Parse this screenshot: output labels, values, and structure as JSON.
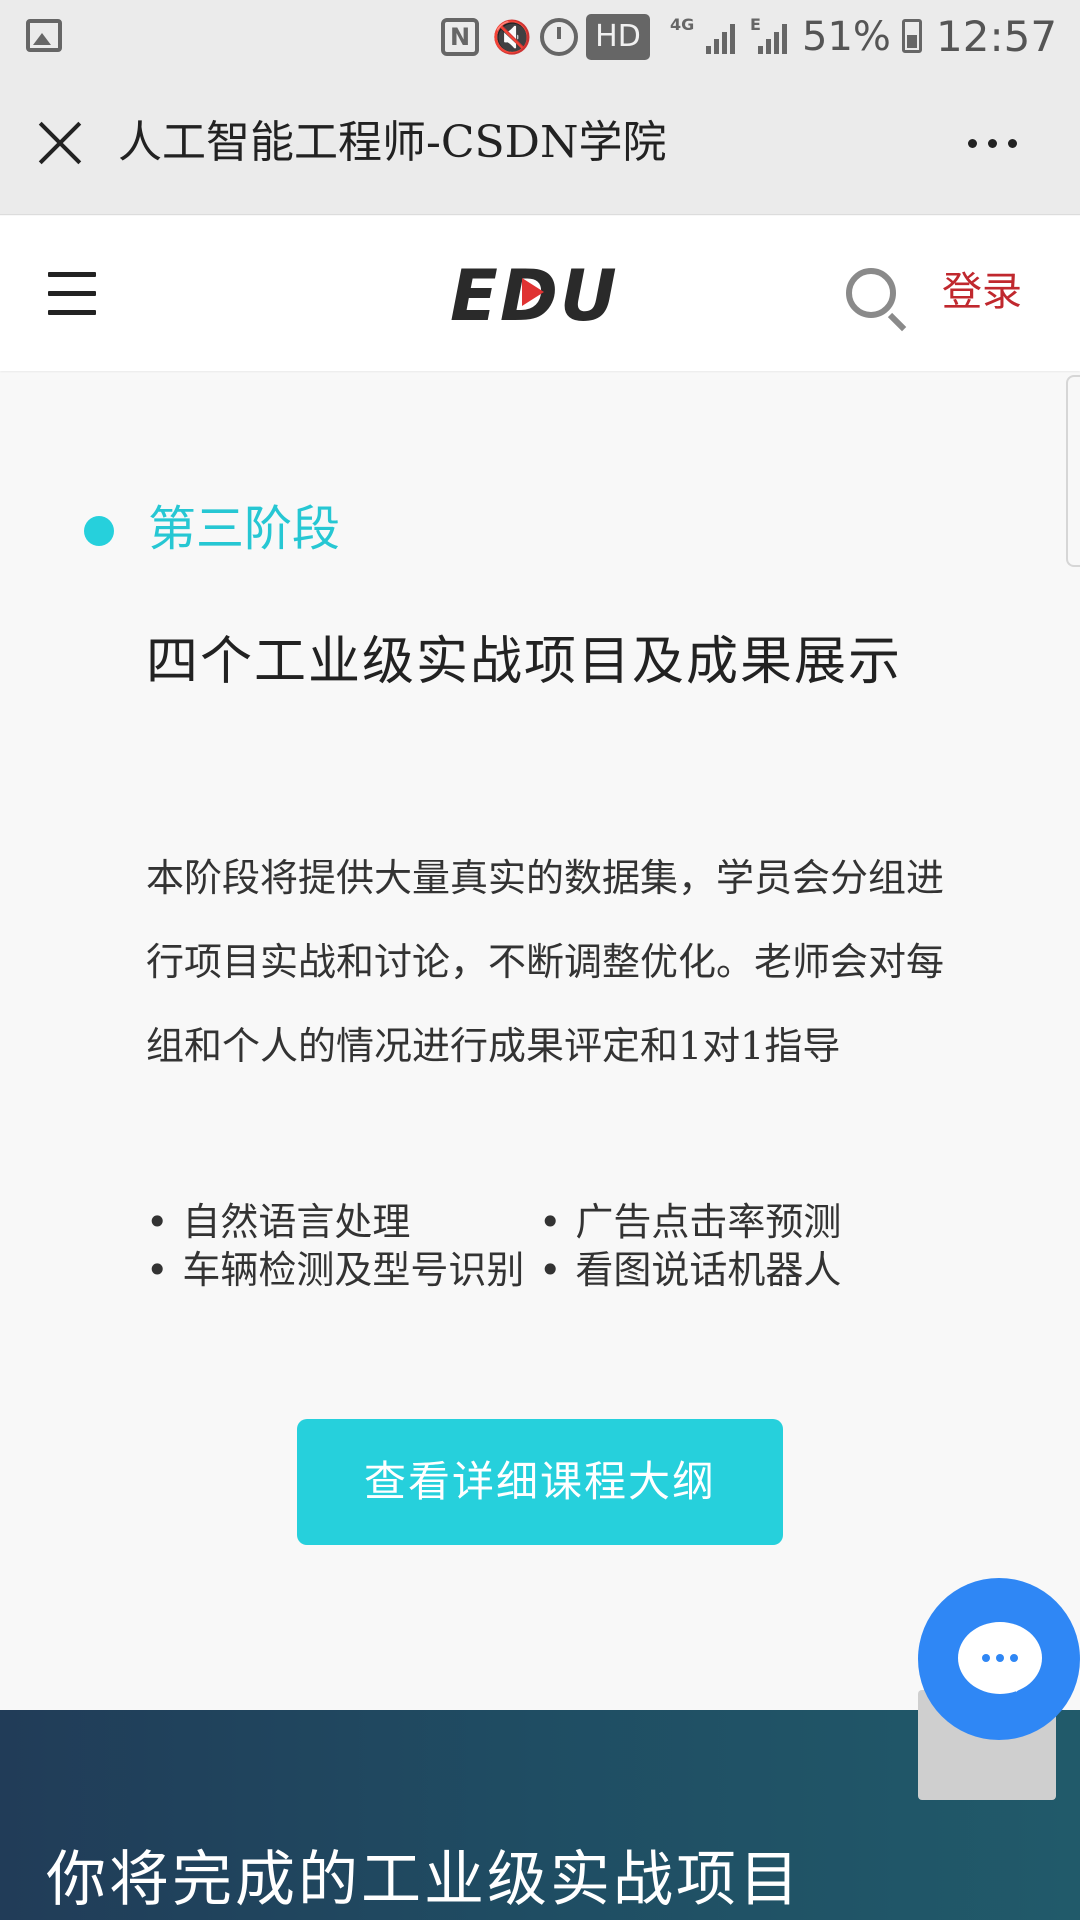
{
  "status_bar": {
    "hd": "HD",
    "network": "4G",
    "network_secondary": "E",
    "battery_percent": "51%",
    "battery_level": 0.51,
    "time": "12:57"
  },
  "app_bar": {
    "title": "人工智能工程师-CSDN学院"
  },
  "site_header": {
    "logo": "EDU",
    "login": "登录"
  },
  "stage": {
    "label": "第三阶段",
    "title": "四个工业级实战项目及成果展示",
    "description": "本阶段将提供大量真实的数据集，学员会分组进行项目实战和讨论，不断调整优化。老师会对每组和个人的情况进行成果评定和1对1指导",
    "bullets": [
      "自然语言处理",
      "广告点击率预测",
      "车辆检测及型号识别",
      "看图说话机器人"
    ],
    "button": "查看详细课程大纲"
  },
  "colors": {
    "accent": "#26d0dc",
    "login": "#c0282e",
    "chat": "#2f87f5",
    "dark_section": "#1f4d63"
  },
  "projects_section": {
    "heading": "你将完成的工业级实战项目"
  }
}
